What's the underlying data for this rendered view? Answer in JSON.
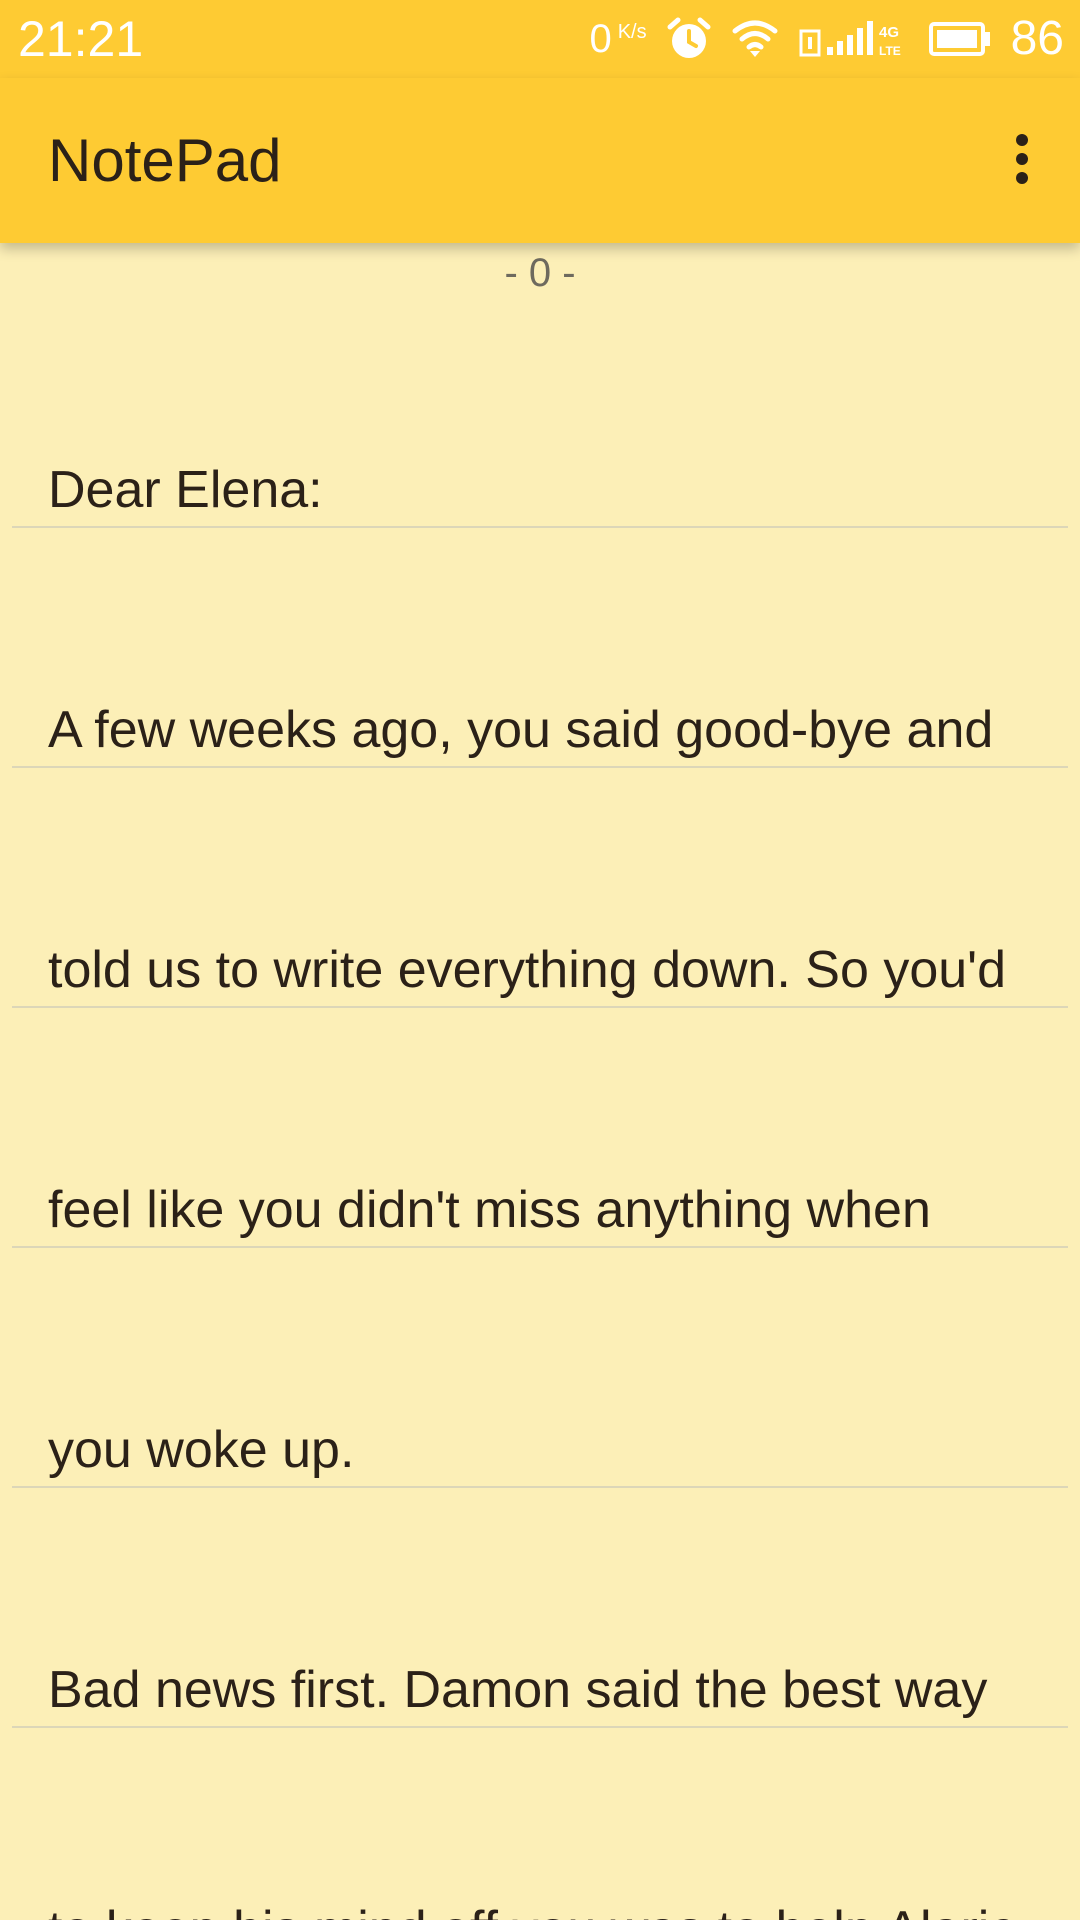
{
  "status_bar": {
    "time": "21:21",
    "net_speed": "0",
    "net_speed_unit": "K/s",
    "battery": "86",
    "icons": [
      "alarm-icon",
      "wifi-icon",
      "sim-icon",
      "signal-icon",
      "4g-lte-icon",
      "battery-icon"
    ]
  },
  "app_bar": {
    "title": "NotePad",
    "menu_icon": "more-vert-icon"
  },
  "note": {
    "page_indicator": "- 0 -",
    "lines": [
      "Dear Elena:",
      "A few weeks ago, you said good-bye and",
      "told us to write everything down. So you'd",
      "feel like you didn't miss anything when",
      "you woke up.",
      "Bad news first. Damon said the best way",
      "to keep his mind off you was to help Alaric"
    ]
  },
  "colors": {
    "bar": "#fecb33",
    "paper": "#fcefb7",
    "rule": "#dcd6b8",
    "text": "#2b2118"
  }
}
